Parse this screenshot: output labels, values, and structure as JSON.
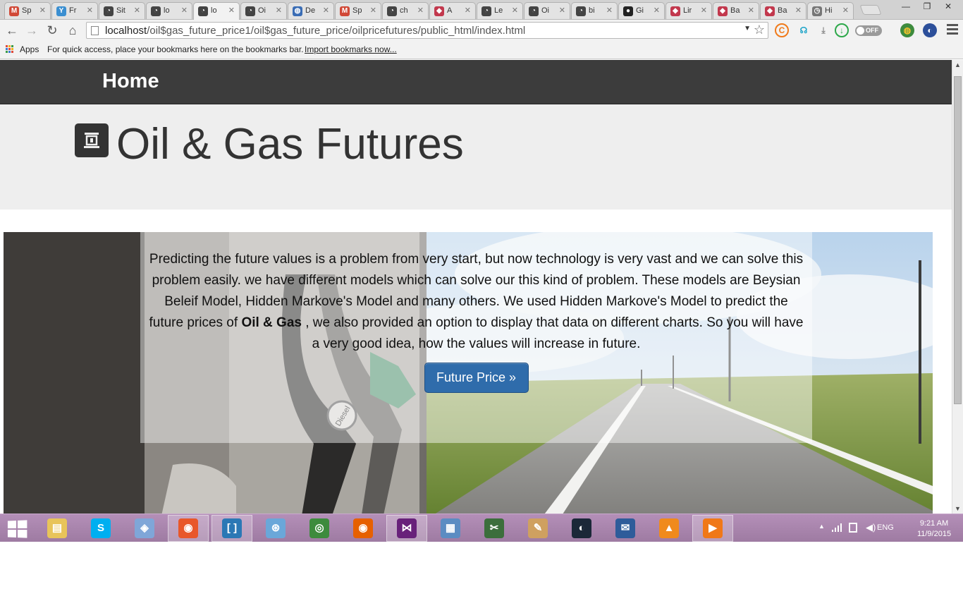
{
  "browser": {
    "tabs": [
      {
        "title": "Sp",
        "icon": "gmail-icon",
        "color": "#d14836",
        "glyph": "M"
      },
      {
        "title": "Fr",
        "icon": "yahoo-icon",
        "color": "#3b8fd1",
        "glyph": "Y"
      },
      {
        "title": "Sit",
        "icon": "localhost-spinner-icon",
        "color": "#444",
        "glyph": "◔"
      },
      {
        "title": "lo",
        "icon": "localhost-spinner-icon",
        "color": "#444",
        "glyph": "◔"
      },
      {
        "title": "lo",
        "icon": "localhost-spinner-icon",
        "color": "#444",
        "glyph": "◔",
        "active": true
      },
      {
        "title": "Oi",
        "icon": "localhost-spinner-icon",
        "color": "#444",
        "glyph": "◔"
      },
      {
        "title": "De",
        "icon": "globe-icon",
        "color": "#3a6db5",
        "glyph": "◍"
      },
      {
        "title": "Sp",
        "icon": "gmail-icon",
        "color": "#d14836",
        "glyph": "M"
      },
      {
        "title": "ch",
        "icon": "localhost-spinner-icon",
        "color": "#444",
        "glyph": "◔"
      },
      {
        "title": "A",
        "icon": "stackexchange-icon",
        "color": "#c2384d",
        "glyph": "◆"
      },
      {
        "title": "Le",
        "icon": "localhost-spinner-icon",
        "color": "#444",
        "glyph": "◔"
      },
      {
        "title": "Oi",
        "icon": "localhost-spinner-icon",
        "color": "#444",
        "glyph": "◔"
      },
      {
        "title": "bi",
        "icon": "localhost-spinner-icon",
        "color": "#444",
        "glyph": "◔"
      },
      {
        "title": "Gi",
        "icon": "github-icon",
        "color": "#222",
        "glyph": "●"
      },
      {
        "title": "Lir",
        "icon": "stackexchange-icon",
        "color": "#c2384d",
        "glyph": "◆"
      },
      {
        "title": "Ba",
        "icon": "stackexchange-icon",
        "color": "#c2384d",
        "glyph": "◆"
      },
      {
        "title": "Ba",
        "icon": "stackexchange-icon",
        "color": "#c2384d",
        "glyph": "◆"
      },
      {
        "title": "Hi",
        "icon": "history-icon",
        "color": "#777",
        "glyph": "◷"
      }
    ],
    "window_controls": {
      "minimize": "—",
      "restore": "❐",
      "close": "✕"
    },
    "url": {
      "host": "localhost",
      "path": "/oil$gas_future_price1/oil$gas_future_price/oilpricefutures/public_html/index.html"
    },
    "bookmarks": {
      "apps_label": "Apps",
      "message": "For quick access, place your bookmarks here on the bookmarks bar.",
      "import_link": "Import bookmarks now..."
    },
    "extensions": {
      "toggle_label": "OFF"
    }
  },
  "page": {
    "nav_brand": "Home",
    "title": "Oil & Gas Futures",
    "hero": {
      "text_before": "Predicting the future values is a problem from very start, but now technology is very vast and we can solve this problem easily. we have different models which can solve our this kind of problem. These models are Beysian Beleif Model, Hidden Markove's Model and many others. We used Hidden Markove's Model to predict the future prices of",
      "bold": "Oil & Gas",
      "text_after": ", we also provided an option to display that data on different charts. So you will have a very good idea, how the values will increase in future.",
      "button_label": "Future Price »",
      "pump_label": "Diesel"
    }
  },
  "taskbar": {
    "apps": [
      {
        "name": "file-explorer-icon",
        "color": "#e8c45a",
        "glyph": "▤"
      },
      {
        "name": "skype-icon",
        "color": "#00aff0",
        "glyph": "S"
      },
      {
        "name": "virtualbox-icon",
        "color": "#7fa6d8",
        "glyph": "◈"
      },
      {
        "name": "firefox-dev-icon",
        "color": "#e8572a",
        "glyph": "◉",
        "open": true
      },
      {
        "name": "brackets-icon",
        "color": "#2b78b5",
        "glyph": "[ ]",
        "open": true
      },
      {
        "name": "safari-icon",
        "color": "#6aa7d9",
        "glyph": "⊛"
      },
      {
        "name": "chrome-icon",
        "color": "#3d8b3d",
        "glyph": "◎"
      },
      {
        "name": "firefox-icon",
        "color": "#e66000",
        "glyph": "◉"
      },
      {
        "name": "visual-studio-icon",
        "color": "#68217a",
        "glyph": "⋈",
        "open": true
      },
      {
        "name": "control-panel-icon",
        "color": "#5b8cc2",
        "glyph": "▦"
      },
      {
        "name": "snipping-tool-icon",
        "color": "#3c6e3c",
        "glyph": "✂"
      },
      {
        "name": "paint-icon",
        "color": "#cfa060",
        "glyph": "✎"
      },
      {
        "name": "steam-icon",
        "color": "#1b2838",
        "glyph": "◐"
      },
      {
        "name": "thunderbird-icon",
        "color": "#2e5c9a",
        "glyph": "✉"
      },
      {
        "name": "vlc-icon",
        "color": "#f08a1c",
        "glyph": "▲"
      },
      {
        "name": "media-player-icon",
        "color": "#f07818",
        "glyph": "▶",
        "open": true
      }
    ],
    "tray": {
      "language": "ENG",
      "time": "9:21 AM",
      "date": "11/9/2015"
    }
  }
}
